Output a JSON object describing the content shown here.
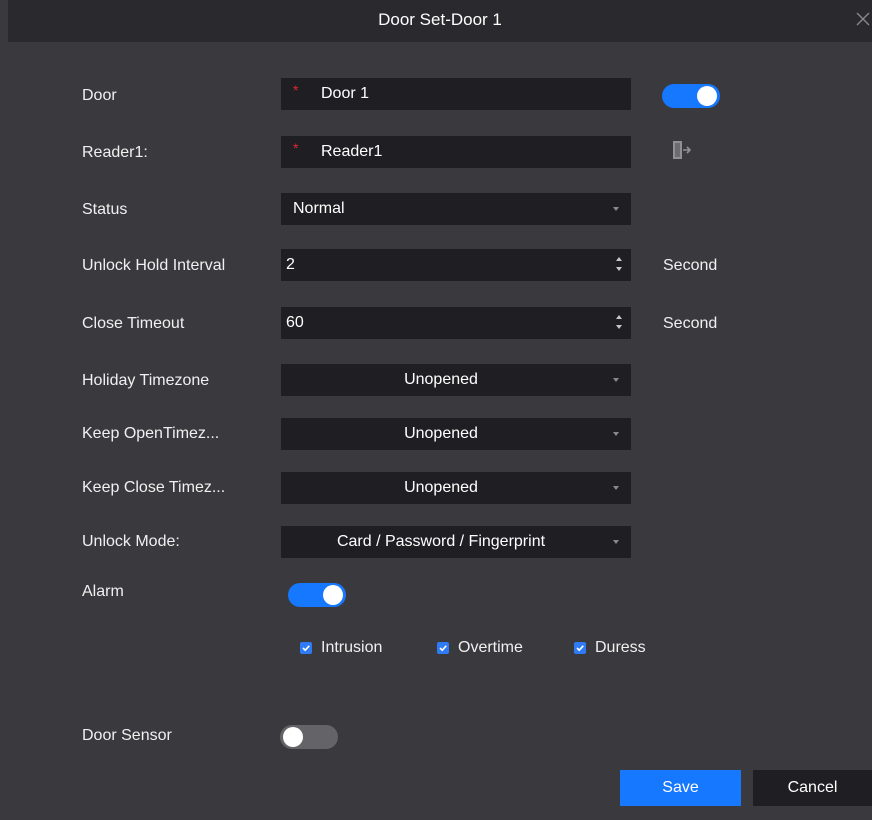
{
  "dialog": {
    "title": "Door Set-Door 1",
    "close_icon": "close-icon"
  },
  "colors": {
    "accent": "#1677ff",
    "required": "#e3262d",
    "background": "#3a3a3e",
    "field_bg": "#1f1f23"
  },
  "form": {
    "door": {
      "label": "Door",
      "value": "Door 1",
      "required_mark": "*",
      "enabled": true
    },
    "reader1": {
      "label": "Reader1:",
      "value": "Reader1",
      "required_mark": "*",
      "icon": "door-exit-icon"
    },
    "status": {
      "label": "Status",
      "value": "Normal"
    },
    "unlock_hold_interval": {
      "label": "Unlock Hold Interval",
      "value": "2",
      "unit": "Second"
    },
    "close_timeout": {
      "label": "Close Timeout",
      "value": "60",
      "unit": "Second"
    },
    "holiday_timezone": {
      "label": "Holiday Timezone",
      "value": "Unopened"
    },
    "keep_open_timezone": {
      "label": "Keep OpenTimez...",
      "value": "Unopened"
    },
    "keep_close_timezone": {
      "label": "Keep Close Timez...",
      "value": "Unopened"
    },
    "unlock_mode": {
      "label": "Unlock Mode:",
      "value": "Card / Password / Fingerprint"
    },
    "alarm": {
      "label": "Alarm",
      "enabled": true,
      "options": [
        {
          "label": "Intrusion",
          "checked": true
        },
        {
          "label": "Overtime",
          "checked": true
        },
        {
          "label": "Duress",
          "checked": true
        }
      ]
    },
    "door_sensor": {
      "label": "Door Sensor",
      "enabled": false
    }
  },
  "buttons": {
    "save": "Save",
    "cancel": "Cancel"
  }
}
